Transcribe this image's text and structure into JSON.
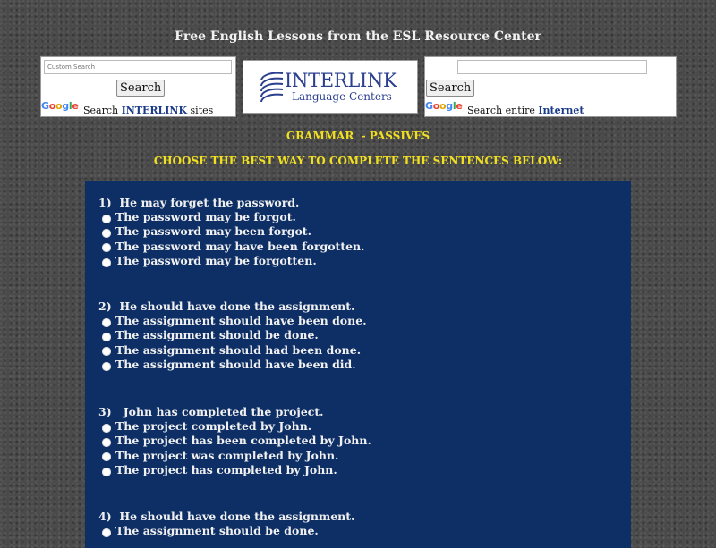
{
  "header": {
    "title": "Free English Lessons from the ESL Resource Center"
  },
  "search_left": {
    "placeholder": "Custom Search",
    "button_label": "Search",
    "google_logo_text": "Google",
    "caption_prefix": "Search",
    "caption_bold": "INTERLINK",
    "caption_suffix": "sites"
  },
  "logo": {
    "main_text": "INTERLINK",
    "sub_text": "Language Centers",
    "color": "#2b3f8f"
  },
  "search_right": {
    "value": "",
    "button_label": "Search",
    "google_logo_text": "Google",
    "caption_prefix": "Search entire",
    "caption_bold": "Internet"
  },
  "section_heading": "GRAMMAR  - PASSIVES",
  "instructions": "CHOOSE THE BEST WAY TO COMPLETE THE SENTENCES BELOW:",
  "colors": {
    "panel_bg": "#0e2f66",
    "heading_yellow": "#f0e020",
    "page_bg": "#4a4a4a"
  },
  "questions": [
    {
      "number": "1)",
      "prompt": "He may forget the password.",
      "options": [
        "The password may be forgot.",
        "The password may been forgot.",
        "The password may have been forgotten.",
        "The password may be forgotten."
      ]
    },
    {
      "number": "2)",
      "prompt": "He should have done the assignment.",
      "options": [
        "The assignment should have been done.",
        "The assignment should be done.",
        "The assignment should had been done.",
        "The assignment should have been did."
      ]
    },
    {
      "number": "3)",
      "prompt": "John has completed the project.",
      "options": [
        "The project completed by John.",
        "The project has been completed by John.",
        "The project was completed by John.",
        "The project has completed by John."
      ]
    },
    {
      "number": "4)",
      "prompt": "He should have done the assignment.",
      "options": [
        "The assignment should be done."
      ]
    }
  ]
}
